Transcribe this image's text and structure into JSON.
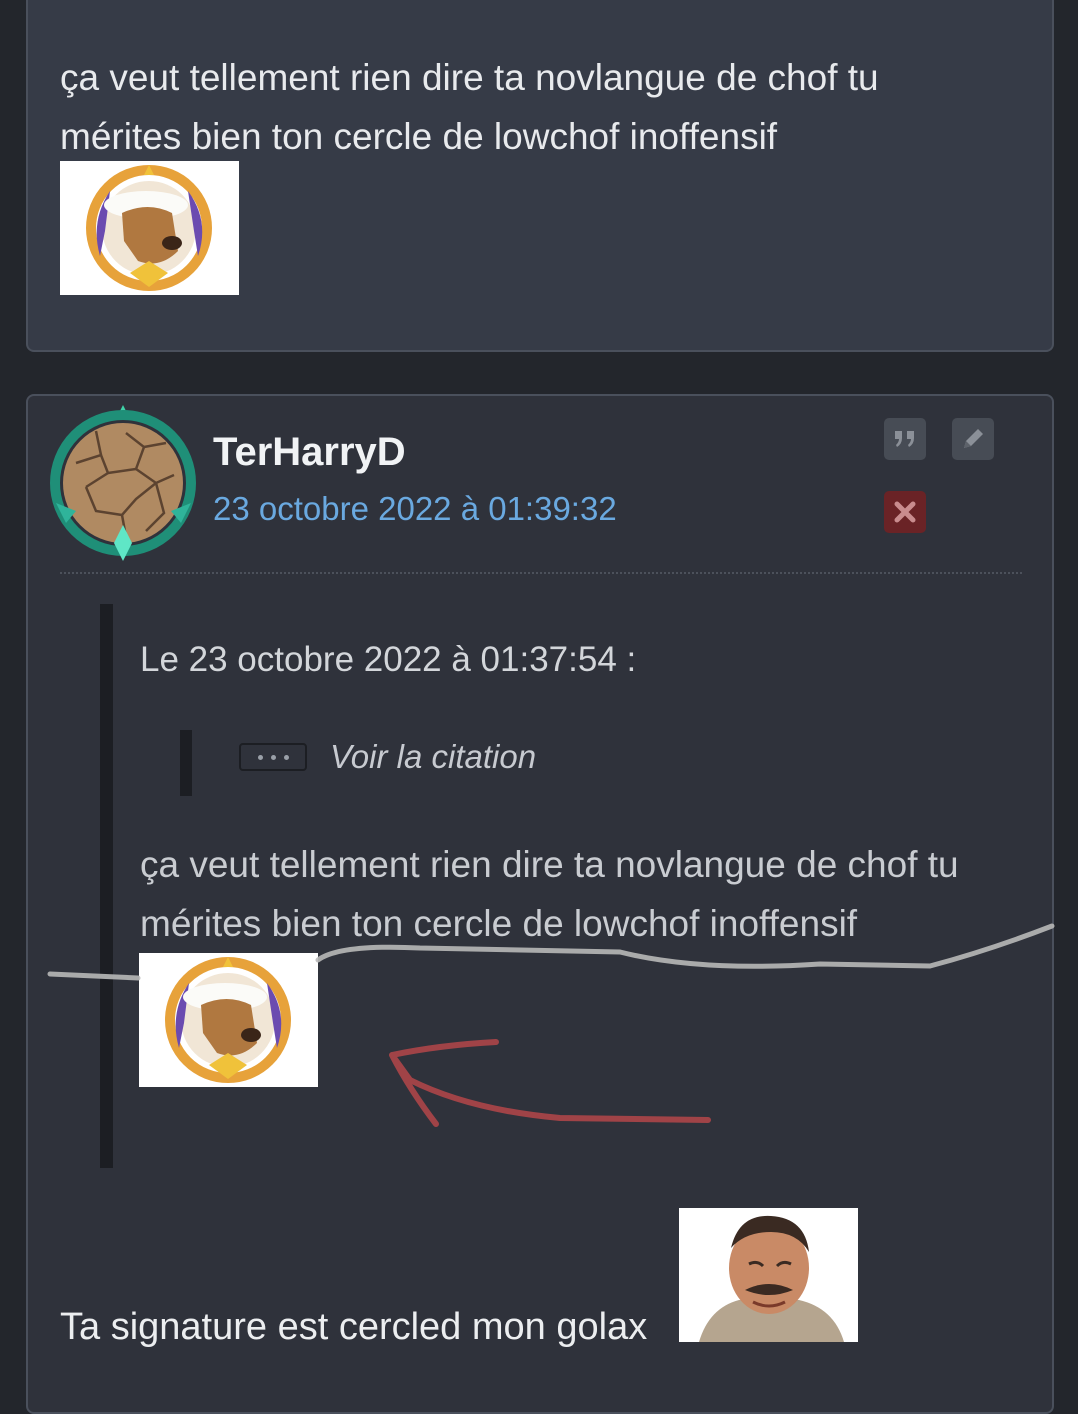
{
  "previous_post": {
    "message": "ça veut tellement rien dire ta novlangue de chof tu mérites bien ton cercle de lowchof inoffensif",
    "sticker": "dog-chef-badge-sticker"
  },
  "post": {
    "username": "TerHarryD",
    "date": "23 octobre 2022 à 01:39:32",
    "avatar": "cracked-earth-badge-avatar",
    "actions": {
      "quote_icon": "quote-icon",
      "edit_icon": "pencil-icon",
      "delete_icon": "close-icon"
    },
    "quote": {
      "header": "Le 23 octobre 2022 à 01:37:54 :",
      "nested_quote_label": "Voir la citation",
      "text": "ça veut tellement rien dire ta novlangue de chof tu mérites bien ton cercle de lowchof inoffensif",
      "sticker": "dog-chef-badge-sticker"
    },
    "reply": "Ta signature est cercled mon golax",
    "reply_sticker": "laughing-man-sticker"
  },
  "colors": {
    "background": "#23262c",
    "card": "#363b47",
    "date": "#6aa9e0",
    "delete_button": "#6a2326",
    "annotation_arrow": "#b4474a",
    "annotation_line": "#b8b8b8"
  }
}
